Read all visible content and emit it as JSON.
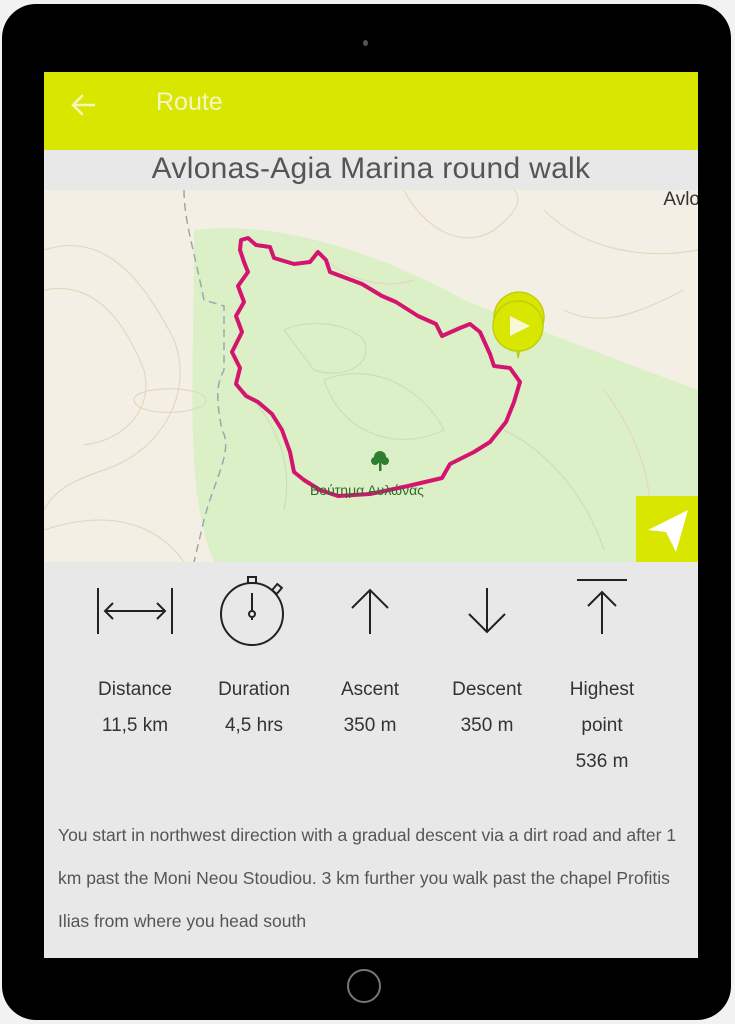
{
  "appbar": {
    "back_icon": "arrow-left-icon",
    "title": "Route"
  },
  "route": {
    "title": "Avlonas-Agia Marina round walk"
  },
  "map": {
    "place_label": "Avlo",
    "poi_label": "Βούτημα Αυλώνας",
    "poi_icon": "tree-icon",
    "start_marker_icon": "play-icon",
    "locate_button_icon": "navigation-arrow-icon",
    "route_color": "#d4146e",
    "accent_color": "#d8e600"
  },
  "stats": [
    {
      "icon": "distance-icon",
      "label": "Distance",
      "value": "11,5 km"
    },
    {
      "icon": "stopwatch-icon",
      "label": "Duration",
      "value": "4,5 hrs"
    },
    {
      "icon": "arrow-up-icon",
      "label": "Ascent",
      "value": "350 m"
    },
    {
      "icon": "arrow-down-icon",
      "label": "Descent",
      "value": "350 m"
    },
    {
      "icon": "highest-point-icon",
      "label": "Highest point",
      "value": "536 m"
    }
  ],
  "description": "You start in northwest direction with a gradual descent via a dirt road and after 1 km past the Moni Neou Stoudiou. 3 km further you walk past the chapel Profitis Ilias from where you head south"
}
